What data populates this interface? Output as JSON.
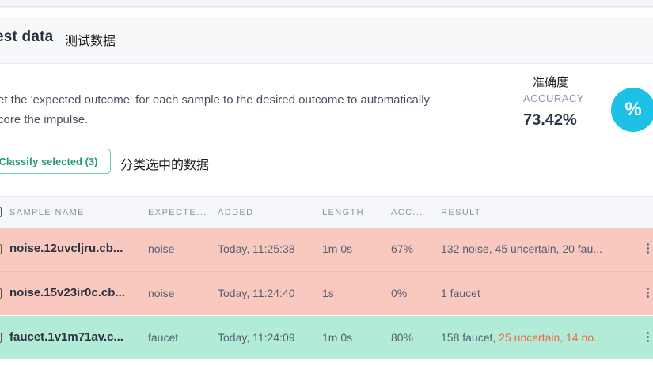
{
  "section": {
    "title": "est data",
    "title_cn": "测试数据",
    "description_line1": "et the 'expected outcome' for each sample to the desired outcome to automatically",
    "description_line2": "core the impulse."
  },
  "accuracy": {
    "cn": "准确度",
    "label": "ACCURACY",
    "value": "73.42%",
    "badge": "%",
    "badge_color": "#1ec1e6"
  },
  "actions": {
    "classify_label": "Classify selected (3)",
    "classify_cn": "分类选中的数据"
  },
  "table": {
    "columns": [
      "SAMPLE NAME",
      "EXPECTE...",
      "ADDED",
      "LENGTH",
      "ACC...",
      "RESULT"
    ],
    "rows": [
      {
        "name": "noise.12uvcljru.cb...",
        "expected": "noise",
        "added": "Today, 11:25:38",
        "length": "1m 0s",
        "accuracy": "67%",
        "result_main": "132 noise, 45 uncertain, 20 fau...",
        "result_warn1": "",
        "result_warn2": "",
        "status": "incorrect"
      },
      {
        "name": "noise.15v23ir0c.cb...",
        "expected": "noise",
        "added": "Today, 11:24:40",
        "length": "1s",
        "accuracy": "0%",
        "result_main": "1 faucet",
        "result_warn1": "",
        "result_warn2": "",
        "status": "incorrect"
      },
      {
        "name": "faucet.1v1m71av.c...",
        "expected": "faucet",
        "added": "Today, 11:24:09",
        "length": "1m 0s",
        "accuracy": "80%",
        "result_main": "158 faucet, ",
        "result_warn1": "25 uncertain",
        "result_warn2": "14 no...",
        "status": "correct"
      }
    ]
  },
  "colors": {
    "row_incorrect": "#f9c9bf",
    "row_correct": "#b3ebd9",
    "warning_text": "#f06a3a"
  }
}
